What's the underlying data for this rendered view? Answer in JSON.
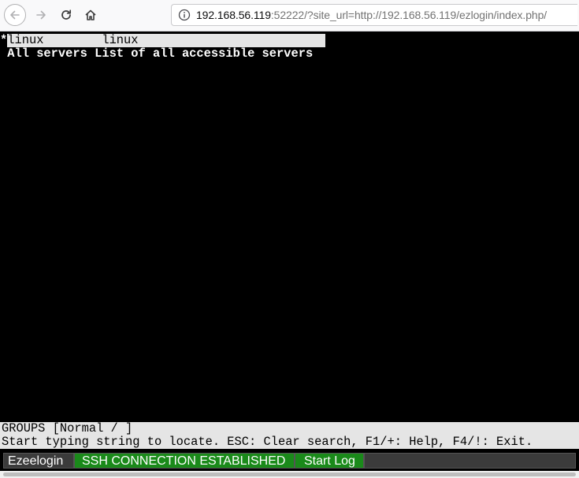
{
  "browser": {
    "url_host": "192.168.56.119",
    "url_rest": ":52222/?site_url=http://192.168.56.119/ezlogin/index.php/"
  },
  "terminal": {
    "rows": [
      {
        "marker": "*",
        "name": "linux",
        "description": "linux",
        "selected": true
      },
      {
        "marker": " ",
        "name": "All servers",
        "description": "List of all accessible servers",
        "selected": false
      }
    ]
  },
  "status": {
    "groups_line": "GROUPS [Normal / ]",
    "help_line": "Start typing string to locate. ESC: Clear search, F1/+: Help, F4/!: Exit."
  },
  "bottom_bar": {
    "brand_label": "Ezeelogin",
    "connection_label": "SSH CONNECTION ESTABLISHED",
    "log_label": "Start Log",
    "accent_green": "#1a8a1a"
  },
  "icons": [
    "back-icon",
    "forward-icon",
    "reload-icon",
    "home-icon",
    "info-icon"
  ]
}
